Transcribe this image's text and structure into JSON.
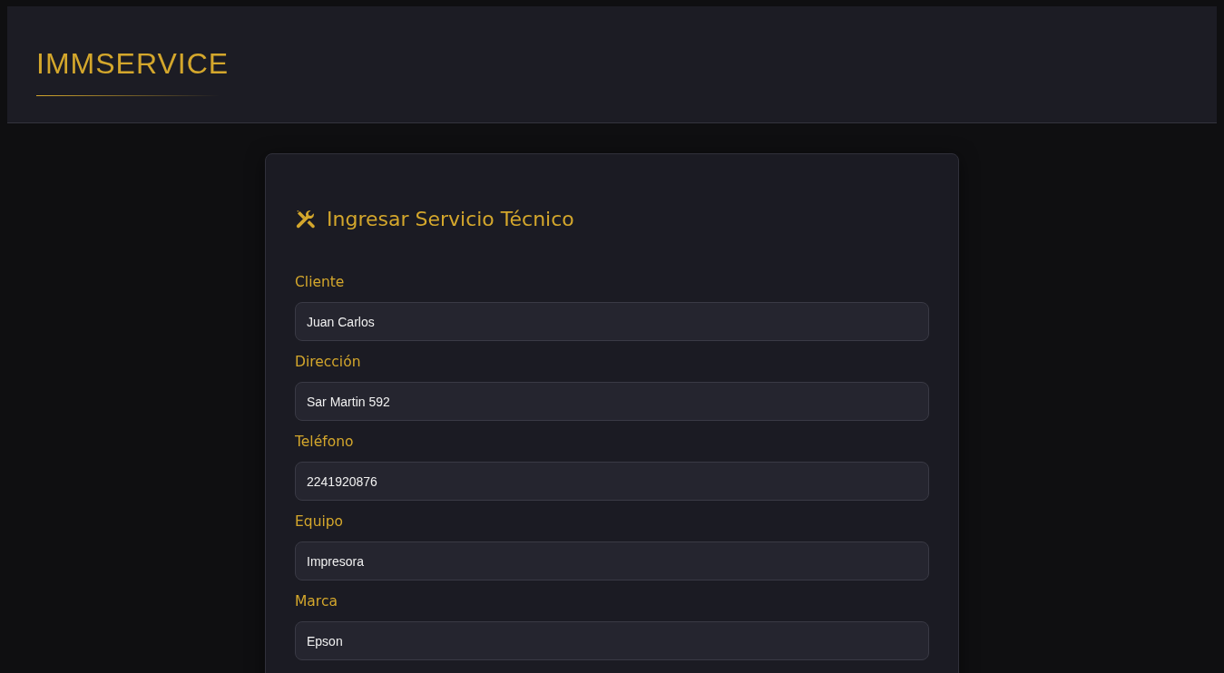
{
  "header": {
    "brand": "IMMSERVICE"
  },
  "form": {
    "title": "Ingresar Servicio Técnico",
    "fields": [
      {
        "label": "Cliente",
        "value": "Juan Carlos"
      },
      {
        "label": "Dirección",
        "value": "Sar Martin 592"
      },
      {
        "label": "Teléfono",
        "value": "2241920876"
      },
      {
        "label": "Equipo",
        "value": "Impresora"
      },
      {
        "label": "Marca",
        "value": "Epson"
      }
    ]
  }
}
